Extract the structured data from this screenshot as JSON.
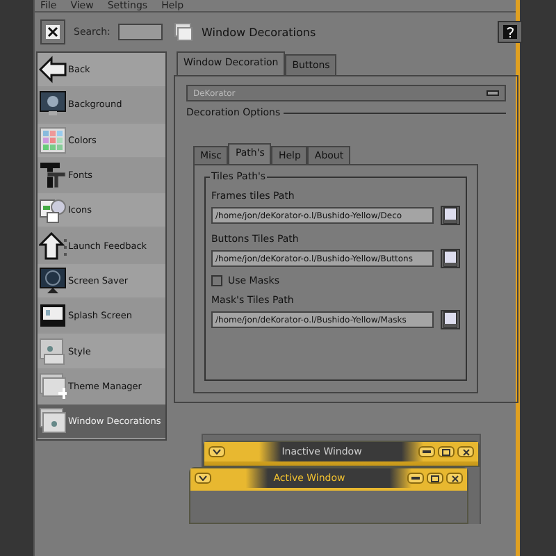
{
  "menu": [
    {
      "label": "File"
    },
    {
      "label": "View"
    },
    {
      "label": "Settings"
    },
    {
      "label": "Help"
    }
  ],
  "search": {
    "label": "Search:"
  },
  "sidebar": {
    "items": [
      {
        "label": "Back",
        "kind": "back",
        "selected": false
      },
      {
        "label": "Background",
        "kind": "background",
        "selected": false
      },
      {
        "label": "Colors",
        "kind": "colors",
        "selected": false
      },
      {
        "label": "Fonts",
        "kind": "fonts",
        "selected": false
      },
      {
        "label": "Icons",
        "kind": "icons",
        "selected": false
      },
      {
        "label": "Launch Feedback",
        "kind": "launch",
        "selected": false
      },
      {
        "label": "Screen Saver",
        "kind": "screensaver",
        "selected": false
      },
      {
        "label": "Splash Screen",
        "kind": "splash",
        "selected": false
      },
      {
        "label": "Style",
        "kind": "style",
        "selected": false
      },
      {
        "label": "Theme Manager",
        "kind": "theme",
        "selected": false
      },
      {
        "label": "Window Decorations",
        "kind": "windows",
        "selected": true
      }
    ]
  },
  "header": {
    "title": "Window Decorations"
  },
  "tabs": [
    {
      "label": "Window Decoration",
      "selected": true
    },
    {
      "label": "Buttons",
      "selected": false
    }
  ],
  "decoration_select": {
    "value": "DeKorator"
  },
  "options_group": {
    "title": "Decoration Options"
  },
  "inner_tabs": [
    {
      "label": "Misc",
      "selected": false
    },
    {
      "label": "Path's",
      "selected": true
    },
    {
      "label": "Help",
      "selected": false
    },
    {
      "label": "About",
      "selected": false
    }
  ],
  "tiles_group": {
    "title": "Tiles Path's",
    "rows": [
      {
        "kind": "label",
        "text": "Frames tiles Path"
      },
      {
        "kind": "path",
        "value": "/home/jon/deKorator-o.l/Bushido-Yellow/Deco"
      },
      {
        "kind": "label",
        "text": "Buttons Tiles Path"
      },
      {
        "kind": "path",
        "value": "/home/jon/deKorator-o.l/Bushido-Yellow/Buttons"
      },
      {
        "kind": "checkbox",
        "text": "Use Masks",
        "checked": false
      },
      {
        "kind": "label",
        "text": "Mask's Tiles Path"
      },
      {
        "kind": "path",
        "value": "/home/jon/deKorator-o.l/Bushido-Yellow/Masks"
      }
    ]
  },
  "preview": [
    {
      "title": "Inactive Window",
      "active": false
    },
    {
      "title": "Active Window",
      "active": true
    }
  ]
}
